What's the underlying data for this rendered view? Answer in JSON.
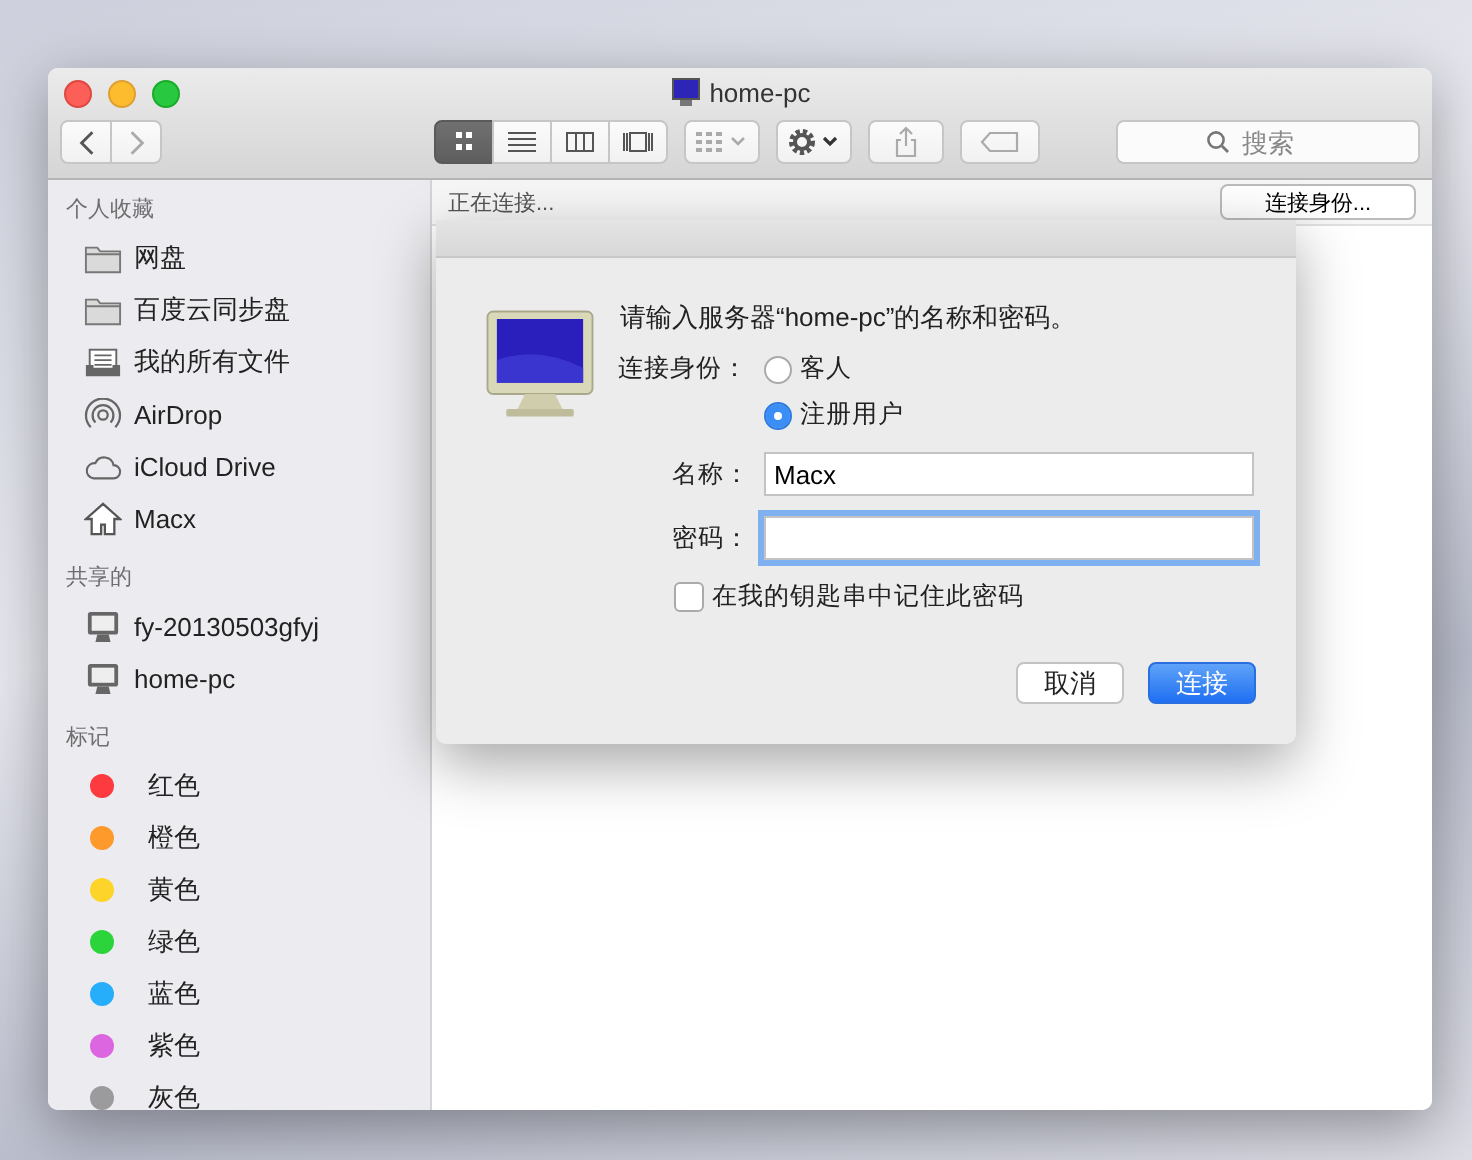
{
  "window": {
    "title": "home-pc"
  },
  "toolbar": {
    "view_modes": [
      {
        "kind": "icons",
        "selected": true
      },
      {
        "kind": "list",
        "selected": false
      },
      {
        "kind": "columns",
        "selected": false
      },
      {
        "kind": "gallery",
        "selected": false
      }
    ]
  },
  "search": {
    "placeholder": "搜索"
  },
  "sidebar": {
    "sections": [
      {
        "heading": "个人收藏",
        "items": [
          {
            "kind": "folder",
            "label": "网盘"
          },
          {
            "kind": "folder",
            "label": "百度云同步盘"
          },
          {
            "kind": "documents",
            "label": "我的所有文件"
          },
          {
            "kind": "airdrop",
            "label": "AirDrop"
          },
          {
            "kind": "cloud",
            "label": "iCloud Drive"
          },
          {
            "kind": "home",
            "label": "Macx"
          }
        ]
      },
      {
        "heading": "共享的",
        "items": [
          {
            "kind": "computer",
            "label": "fy-20130503gfyj"
          },
          {
            "kind": "computer",
            "label": "home-pc"
          }
        ]
      },
      {
        "heading": "标记",
        "items": [
          {
            "kind": "tag",
            "label": "红色",
            "color": "#fc3a3f"
          },
          {
            "kind": "tag",
            "label": "橙色",
            "color": "#fd9a2b"
          },
          {
            "kind": "tag",
            "label": "黄色",
            "color": "#fdd42a"
          },
          {
            "kind": "tag",
            "label": "绿色",
            "color": "#2bd43a"
          },
          {
            "kind": "tag",
            "label": "蓝色",
            "color": "#27aefb"
          },
          {
            "kind": "tag",
            "label": "紫色",
            "color": "#dc66e0"
          },
          {
            "kind": "tag",
            "label": "灰色",
            "color": "#9b9b9e"
          }
        ]
      }
    ]
  },
  "path_bar": {
    "status": "正在连接...",
    "button": "连接身份..."
  },
  "dialog": {
    "message": "请输入服务器“home-pc”的名称和密码。",
    "connect_as_label": "连接身份：",
    "options": [
      {
        "label": "客人",
        "selected": false
      },
      {
        "label": "注册用户",
        "selected": true
      }
    ],
    "fields": [
      {
        "label": "名称：",
        "value": "Macx",
        "focused": false
      },
      {
        "label": "密码：",
        "focused": true
      }
    ],
    "remember": {
      "label": "在我的钥匙串中记住此密码",
      "checked": false
    },
    "buttons": [
      {
        "label": "取消",
        "kind": "secondary"
      },
      {
        "label": "连接",
        "kind": "primary"
      }
    ]
  }
}
